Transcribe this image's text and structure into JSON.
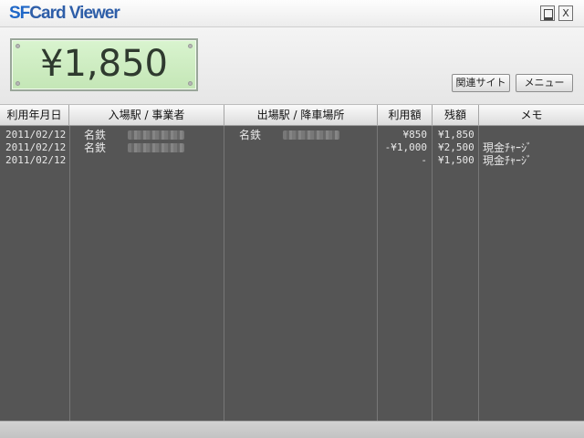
{
  "app": {
    "title_prefix": "SF",
    "title_suffix": "Card Viewer"
  },
  "window_buttons": {
    "close": "X"
  },
  "balance": "¥1,850",
  "buttons": {
    "related_sites": "関連サイト",
    "menu": "メニュー"
  },
  "table": {
    "columns": [
      "利用年月日",
      "入場駅 / 事業者",
      "出場駅 / 降車場所",
      "利用額",
      "残額",
      "メモ"
    ],
    "rows": [
      {
        "date": "2011/02/12",
        "entry": "名鉄",
        "exit": "名鉄",
        "amount": "¥850",
        "balance": "¥1,850",
        "memo": ""
      },
      {
        "date": "2011/02/12",
        "entry": "名鉄",
        "exit": "",
        "amount": "-¥1,000",
        "balance": "¥2,500",
        "memo": "現金ﾁｬｰｼﾞ"
      },
      {
        "date": "2011/02/12",
        "entry": "",
        "exit": "",
        "amount": "-",
        "balance": "¥1,500",
        "memo": "現金ﾁｬｰｼﾞ"
      }
    ]
  }
}
